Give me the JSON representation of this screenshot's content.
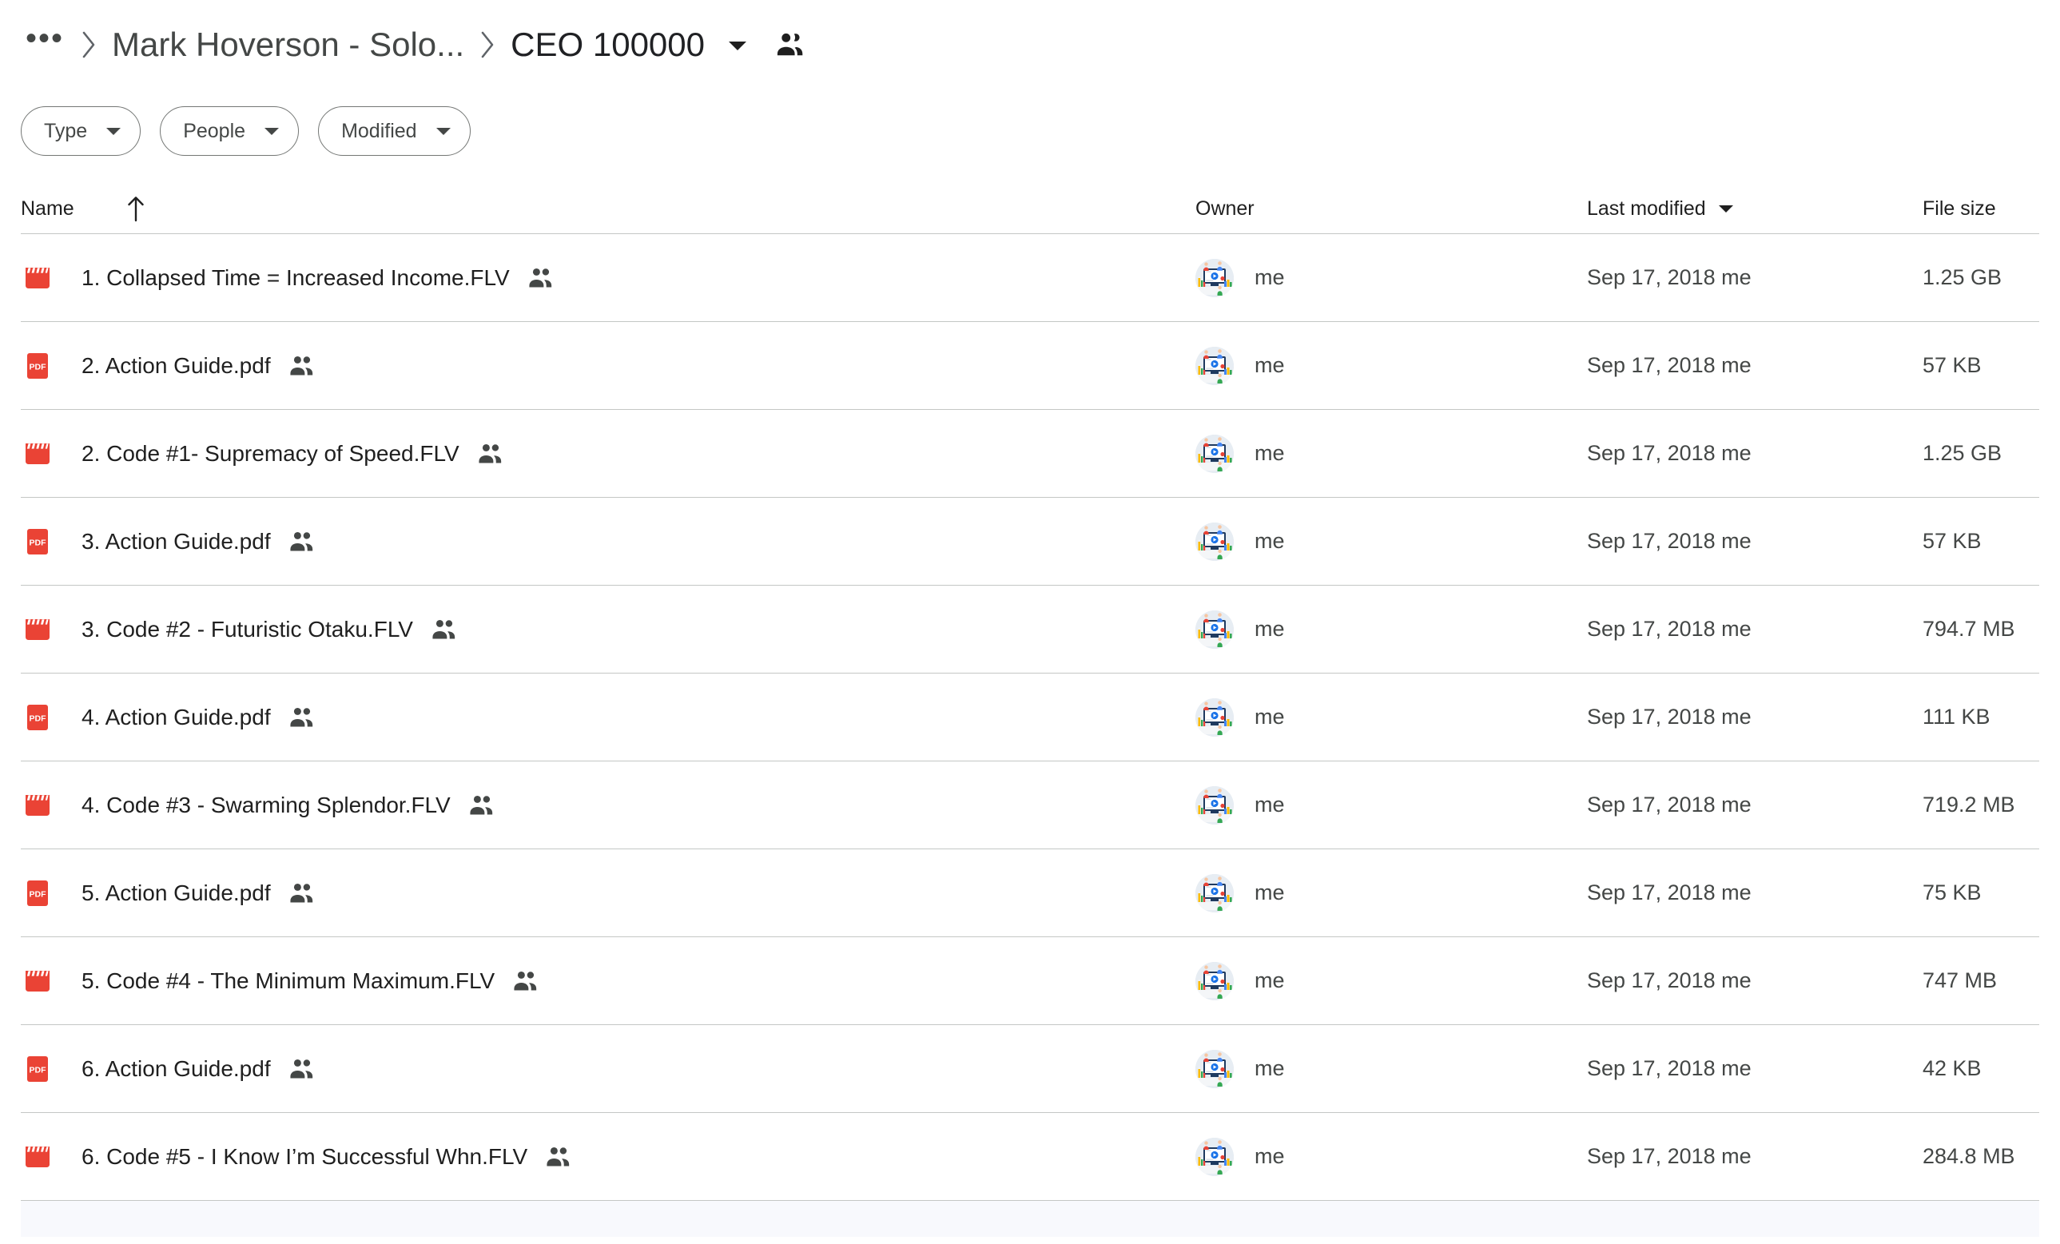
{
  "breadcrumb": {
    "overflow_label": "•••",
    "parent_label": "Mark Hoverson - Solo...",
    "current_label": "CEO 100000",
    "share_icon": "people-icon",
    "caret_icon": "caret-down-icon",
    "separator_icon": "chevron-right-icon"
  },
  "filters": [
    {
      "label": "Type",
      "caret": "caret-down-icon"
    },
    {
      "label": "People",
      "caret": "caret-down-icon"
    },
    {
      "label": "Modified",
      "caret": "caret-down-icon"
    }
  ],
  "table": {
    "columns": {
      "name": "Name",
      "owner": "Owner",
      "modified": "Last modified",
      "size": "File size"
    },
    "sort_icon": "arrow-up-icon",
    "modified_caret": "caret-down-icon",
    "rows": [
      {
        "icon": "video-file-icon",
        "name": "1. Collapsed Time = Increased Income.FLV",
        "shared": true,
        "owner": "me",
        "modified": "Sep 17, 2018 me",
        "size": "1.25 GB"
      },
      {
        "icon": "pdf-file-icon",
        "name": "2. Action Guide.pdf",
        "shared": true,
        "owner": "me",
        "modified": "Sep 17, 2018 me",
        "size": "57 KB"
      },
      {
        "icon": "video-file-icon",
        "name": "2. Code #1- Supremacy of Speed.FLV",
        "shared": true,
        "owner": "me",
        "modified": "Sep 17, 2018 me",
        "size": "1.25 GB"
      },
      {
        "icon": "pdf-file-icon",
        "name": "3. Action Guide.pdf",
        "shared": true,
        "owner": "me",
        "modified": "Sep 17, 2018 me",
        "size": "57 KB"
      },
      {
        "icon": "video-file-icon",
        "name": "3. Code #2 - Futuristic Otaku.FLV",
        "shared": true,
        "owner": "me",
        "modified": "Sep 17, 2018 me",
        "size": "794.7 MB"
      },
      {
        "icon": "pdf-file-icon",
        "name": "4. Action Guide.pdf",
        "shared": true,
        "owner": "me",
        "modified": "Sep 17, 2018 me",
        "size": "111 KB"
      },
      {
        "icon": "video-file-icon",
        "name": "4. Code #3 - Swarming Splendor.FLV",
        "shared": true,
        "owner": "me",
        "modified": "Sep 17, 2018 me",
        "size": "719.2 MB"
      },
      {
        "icon": "pdf-file-icon",
        "name": "5. Action Guide.pdf",
        "shared": true,
        "owner": "me",
        "modified": "Sep 17, 2018 me",
        "size": "75 KB"
      },
      {
        "icon": "video-file-icon",
        "name": "5. Code #4 - The Minimum Maximum.FLV",
        "shared": true,
        "owner": "me",
        "modified": "Sep 17, 2018 me",
        "size": "747 MB"
      },
      {
        "icon": "pdf-file-icon",
        "name": "6. Action Guide.pdf",
        "shared": true,
        "owner": "me",
        "modified": "Sep 17, 2018 me",
        "size": "42 KB"
      },
      {
        "icon": "video-file-icon",
        "name": "6. Code #5 - I Know I’m Successful Whn.FLV",
        "shared": true,
        "owner": "me",
        "modified": "Sep 17, 2018 me",
        "size": "284.8 MB"
      }
    ]
  },
  "colors": {
    "file_red": "#ea4335",
    "text_primary": "#1f1f1f",
    "text_secondary": "#444746",
    "divider": "#c4c7c5",
    "chip_border": "#747775",
    "partial_row_bg": "#f8f9fd"
  }
}
